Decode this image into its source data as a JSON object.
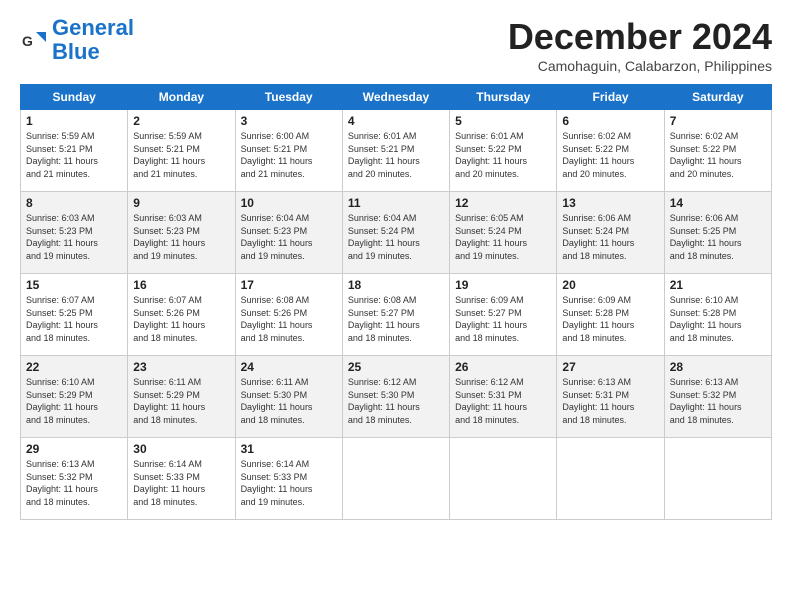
{
  "header": {
    "logo_line1": "General",
    "logo_line2": "Blue",
    "month_title": "December 2024",
    "location": "Camohaguin, Calabarzon, Philippines"
  },
  "weekdays": [
    "Sunday",
    "Monday",
    "Tuesday",
    "Wednesday",
    "Thursday",
    "Friday",
    "Saturday"
  ],
  "weeks": [
    [
      {
        "day": "1",
        "info": "Sunrise: 5:59 AM\nSunset: 5:21 PM\nDaylight: 11 hours\nand 21 minutes."
      },
      {
        "day": "2",
        "info": "Sunrise: 5:59 AM\nSunset: 5:21 PM\nDaylight: 11 hours\nand 21 minutes."
      },
      {
        "day": "3",
        "info": "Sunrise: 6:00 AM\nSunset: 5:21 PM\nDaylight: 11 hours\nand 21 minutes."
      },
      {
        "day": "4",
        "info": "Sunrise: 6:01 AM\nSunset: 5:21 PM\nDaylight: 11 hours\nand 20 minutes."
      },
      {
        "day": "5",
        "info": "Sunrise: 6:01 AM\nSunset: 5:22 PM\nDaylight: 11 hours\nand 20 minutes."
      },
      {
        "day": "6",
        "info": "Sunrise: 6:02 AM\nSunset: 5:22 PM\nDaylight: 11 hours\nand 20 minutes."
      },
      {
        "day": "7",
        "info": "Sunrise: 6:02 AM\nSunset: 5:22 PM\nDaylight: 11 hours\nand 20 minutes."
      }
    ],
    [
      {
        "day": "8",
        "info": "Sunrise: 6:03 AM\nSunset: 5:23 PM\nDaylight: 11 hours\nand 19 minutes."
      },
      {
        "day": "9",
        "info": "Sunrise: 6:03 AM\nSunset: 5:23 PM\nDaylight: 11 hours\nand 19 minutes."
      },
      {
        "day": "10",
        "info": "Sunrise: 6:04 AM\nSunset: 5:23 PM\nDaylight: 11 hours\nand 19 minutes."
      },
      {
        "day": "11",
        "info": "Sunrise: 6:04 AM\nSunset: 5:24 PM\nDaylight: 11 hours\nand 19 minutes."
      },
      {
        "day": "12",
        "info": "Sunrise: 6:05 AM\nSunset: 5:24 PM\nDaylight: 11 hours\nand 19 minutes."
      },
      {
        "day": "13",
        "info": "Sunrise: 6:06 AM\nSunset: 5:24 PM\nDaylight: 11 hours\nand 18 minutes."
      },
      {
        "day": "14",
        "info": "Sunrise: 6:06 AM\nSunset: 5:25 PM\nDaylight: 11 hours\nand 18 minutes."
      }
    ],
    [
      {
        "day": "15",
        "info": "Sunrise: 6:07 AM\nSunset: 5:25 PM\nDaylight: 11 hours\nand 18 minutes."
      },
      {
        "day": "16",
        "info": "Sunrise: 6:07 AM\nSunset: 5:26 PM\nDaylight: 11 hours\nand 18 minutes."
      },
      {
        "day": "17",
        "info": "Sunrise: 6:08 AM\nSunset: 5:26 PM\nDaylight: 11 hours\nand 18 minutes."
      },
      {
        "day": "18",
        "info": "Sunrise: 6:08 AM\nSunset: 5:27 PM\nDaylight: 11 hours\nand 18 minutes."
      },
      {
        "day": "19",
        "info": "Sunrise: 6:09 AM\nSunset: 5:27 PM\nDaylight: 11 hours\nand 18 minutes."
      },
      {
        "day": "20",
        "info": "Sunrise: 6:09 AM\nSunset: 5:28 PM\nDaylight: 11 hours\nand 18 minutes."
      },
      {
        "day": "21",
        "info": "Sunrise: 6:10 AM\nSunset: 5:28 PM\nDaylight: 11 hours\nand 18 minutes."
      }
    ],
    [
      {
        "day": "22",
        "info": "Sunrise: 6:10 AM\nSunset: 5:29 PM\nDaylight: 11 hours\nand 18 minutes."
      },
      {
        "day": "23",
        "info": "Sunrise: 6:11 AM\nSunset: 5:29 PM\nDaylight: 11 hours\nand 18 minutes."
      },
      {
        "day": "24",
        "info": "Sunrise: 6:11 AM\nSunset: 5:30 PM\nDaylight: 11 hours\nand 18 minutes."
      },
      {
        "day": "25",
        "info": "Sunrise: 6:12 AM\nSunset: 5:30 PM\nDaylight: 11 hours\nand 18 minutes."
      },
      {
        "day": "26",
        "info": "Sunrise: 6:12 AM\nSunset: 5:31 PM\nDaylight: 11 hours\nand 18 minutes."
      },
      {
        "day": "27",
        "info": "Sunrise: 6:13 AM\nSunset: 5:31 PM\nDaylight: 11 hours\nand 18 minutes."
      },
      {
        "day": "28",
        "info": "Sunrise: 6:13 AM\nSunset: 5:32 PM\nDaylight: 11 hours\nand 18 minutes."
      }
    ],
    [
      {
        "day": "29",
        "info": "Sunrise: 6:13 AM\nSunset: 5:32 PM\nDaylight: 11 hours\nand 18 minutes."
      },
      {
        "day": "30",
        "info": "Sunrise: 6:14 AM\nSunset: 5:33 PM\nDaylight: 11 hours\nand 18 minutes."
      },
      {
        "day": "31",
        "info": "Sunrise: 6:14 AM\nSunset: 5:33 PM\nDaylight: 11 hours\nand 19 minutes."
      },
      {
        "day": "",
        "info": ""
      },
      {
        "day": "",
        "info": ""
      },
      {
        "day": "",
        "info": ""
      },
      {
        "day": "",
        "info": ""
      }
    ]
  ]
}
